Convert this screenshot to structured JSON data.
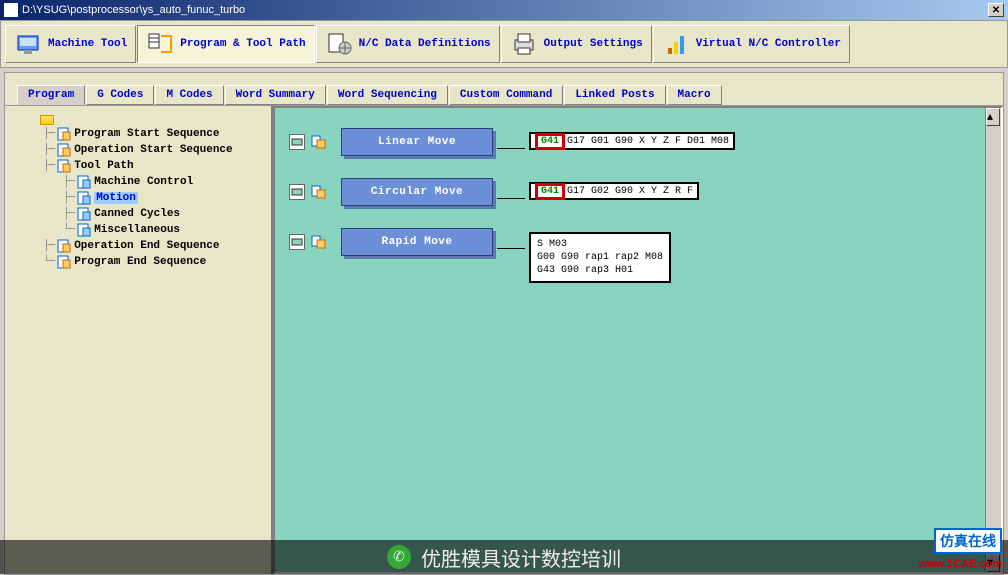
{
  "titlebar": {
    "path": "D:\\YSUG\\postprocessor\\ys_auto_funuc_turbo"
  },
  "toolbar": {
    "items": [
      {
        "label": "Machine Tool"
      },
      {
        "label": "Program & Tool Path"
      },
      {
        "label": "N/C Data Definitions"
      },
      {
        "label": "Output Settings"
      },
      {
        "label": "Virtual N/C Controller"
      }
    ]
  },
  "tabs": {
    "items": [
      {
        "label": "Program"
      },
      {
        "label": "G Codes"
      },
      {
        "label": "M Codes"
      },
      {
        "label": "Word Summary"
      },
      {
        "label": "Word Sequencing"
      },
      {
        "label": "Custom Command"
      },
      {
        "label": "Linked Posts"
      },
      {
        "label": "Macro"
      }
    ]
  },
  "tree": {
    "root": "",
    "items": [
      {
        "label": "Program Start Sequence",
        "level": 1,
        "type": "page"
      },
      {
        "label": "Operation Start Sequence",
        "level": 1,
        "type": "page"
      },
      {
        "label": "Tool Path",
        "level": 1,
        "type": "page"
      },
      {
        "label": "Machine Control",
        "level": 2,
        "type": "page"
      },
      {
        "label": "Motion",
        "level": 2,
        "type": "page",
        "selected": true
      },
      {
        "label": "Canned Cycles",
        "level": 2,
        "type": "page"
      },
      {
        "label": "Miscellaneous",
        "level": 2,
        "type": "page"
      },
      {
        "label": "Operation End Sequence",
        "level": 1,
        "type": "page"
      },
      {
        "label": "Program End Sequence",
        "level": 1,
        "type": "page"
      }
    ]
  },
  "moves": [
    {
      "title": "Linear Move",
      "g41": "G41",
      "code": "G17 G01 G90 X Y Z F D01 M08"
    },
    {
      "title": "Circular Move",
      "g41": "G41",
      "code": "G17 G02 G90 X Y Z R F"
    },
    {
      "title": "Rapid Move",
      "lines": [
        "S M03",
        "G00 G90 rap1 rap2 M08",
        "G43 G90 rap3 H01"
      ]
    }
  ],
  "watermark": {
    "text": "优胜模具设计数控培训",
    "badge": "仿真在线",
    "url": "www.1CAE.com"
  }
}
